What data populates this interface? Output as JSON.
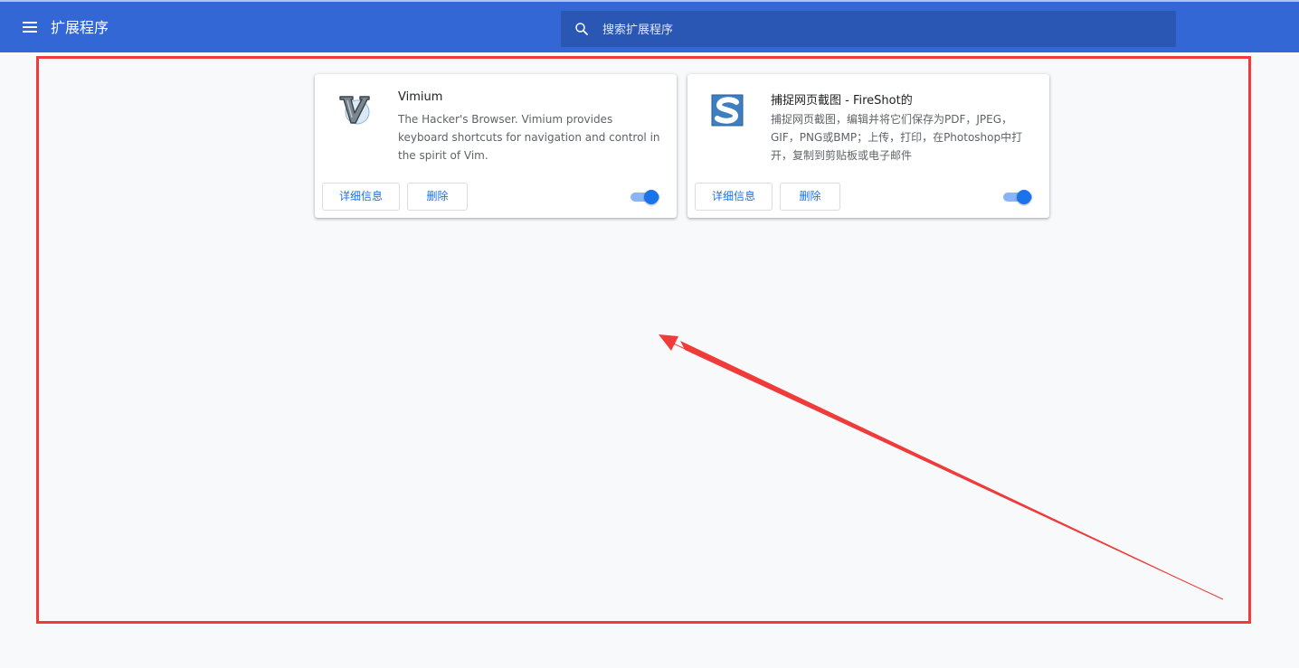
{
  "header": {
    "title": "扩展程序",
    "search_placeholder": "搜索扩展程序"
  },
  "extensions": [
    {
      "name": "Vimium",
      "description": "The Hacker's Browser. Vimium provides keyboard shortcuts for navigation and control in the spirit of Vim.",
      "details_label": "详细信息",
      "remove_label": "删除",
      "enabled": true,
      "icon": "vimium-logo-icon"
    },
    {
      "name": "捕捉网页截图 - FireShot的",
      "description": "捕捉网页截图，编辑并将它们保存为PDF，JPEG，GIF，PNG或BMP；上传，打印，在Photoshop中打开，复制到剪贴板或电子邮件",
      "details_label": "详细信息",
      "remove_label": "删除",
      "enabled": true,
      "icon": "fireshot-logo-icon"
    }
  ],
  "colors": {
    "header_bg": "#3367d6",
    "search_bg": "#2a56b4",
    "accent": "#1a73e8",
    "annotation": "#f03b3b"
  }
}
